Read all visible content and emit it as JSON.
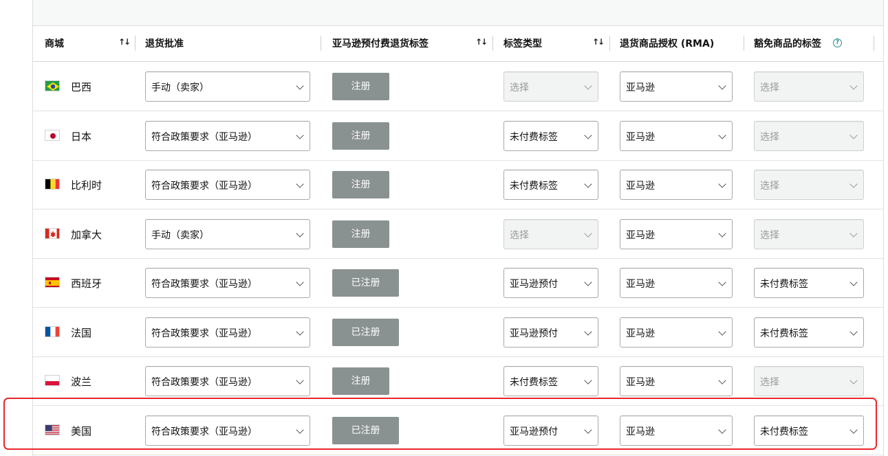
{
  "header": {
    "marketplace": "商城",
    "return_approval": "退货批准",
    "prepaid_label": "亚马逊预付费退货标签",
    "label_type": "标签类型",
    "rma": "退货商品授权 (RMA)",
    "exempt_label": "豁免商品的标签",
    "sort_glyph": "↑↓",
    "help_glyph": "?"
  },
  "colors": {
    "button": "#8a9191",
    "highlight": "#e8262a",
    "help": "#2a8a8f"
  },
  "rows": [
    {
      "flag": "brazil-flag",
      "name": "巴西",
      "approval": "手动（卖家）",
      "button": "注册",
      "label_type": "选择",
      "label_type_disabled": true,
      "rma": "亚马逊",
      "exempt": "选择",
      "exempt_disabled": true
    },
    {
      "flag": "japan-flag",
      "name": "日本",
      "approval": "符合政策要求（亚马逊）",
      "button": "注册",
      "label_type": "未付费标签",
      "label_type_disabled": false,
      "rma": "亚马逊",
      "exempt": "选择",
      "exempt_disabled": true
    },
    {
      "flag": "belgium-flag",
      "name": "比利时",
      "approval": "符合政策要求（亚马逊）",
      "button": "注册",
      "label_type": "未付费标签",
      "label_type_disabled": false,
      "rma": "亚马逊",
      "exempt": "选择",
      "exempt_disabled": true
    },
    {
      "flag": "canada-flag",
      "name": "加拿大",
      "approval": "手动（卖家）",
      "button": "注册",
      "label_type": "选择",
      "label_type_disabled": true,
      "rma": "亚马逊",
      "exempt": "选择",
      "exempt_disabled": true
    },
    {
      "flag": "spain-flag",
      "name": "西班牙",
      "approval": "符合政策要求（亚马逊）",
      "button": "已注册",
      "label_type": "亚马逊预付",
      "label_type_disabled": false,
      "rma": "亚马逊",
      "exempt": "未付费标签",
      "exempt_disabled": false
    },
    {
      "flag": "france-flag",
      "name": "法国",
      "approval": "符合政策要求（亚马逊）",
      "button": "已注册",
      "label_type": "亚马逊预付",
      "label_type_disabled": false,
      "rma": "亚马逊",
      "exempt": "未付费标签",
      "exempt_disabled": false
    },
    {
      "flag": "poland-flag",
      "name": "波兰",
      "approval": "符合政策要求（亚马逊）",
      "button": "注册",
      "label_type": "未付费标签",
      "label_type_disabled": false,
      "rma": "亚马逊",
      "exempt": "选择",
      "exempt_disabled": true
    },
    {
      "flag": "usa-flag",
      "name": "美国",
      "approval": "符合政策要求（亚马逊）",
      "button": "已注册",
      "label_type": "亚马逊预付",
      "label_type_disabled": false,
      "rma": "亚马逊",
      "exempt": "未付费标签",
      "exempt_disabled": false
    }
  ]
}
